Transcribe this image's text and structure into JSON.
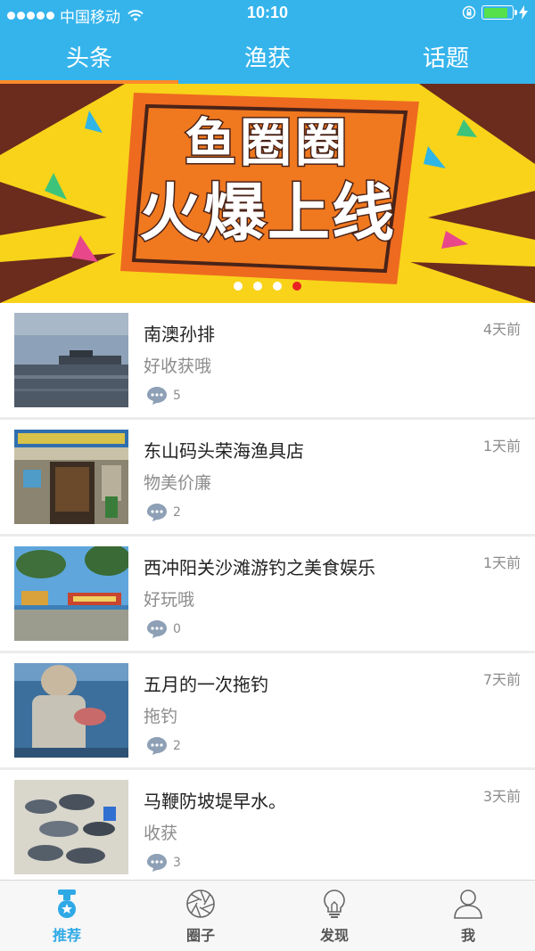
{
  "status_bar": {
    "carrier": "中国移动",
    "time": "10:10"
  },
  "top_tabs": [
    {
      "label": "头条",
      "active": true
    },
    {
      "label": "渔获",
      "active": false
    },
    {
      "label": "话题",
      "active": false
    }
  ],
  "banner": {
    "line1": "鱼圈圈",
    "line2": "火爆上线",
    "slide_count": 4,
    "active_slide": 4
  },
  "feed": [
    {
      "title": "南澳孙排",
      "subtitle": "好收获哦",
      "time": "4天前",
      "comments": "5"
    },
    {
      "title": "东山码头荣海渔具店",
      "subtitle": "物美价廉",
      "time": "1天前",
      "comments": "2"
    },
    {
      "title": "西冲阳关沙滩游钓之美食娱乐",
      "subtitle": "好玩哦",
      "time": "1天前",
      "comments": "0"
    },
    {
      "title": "五月的一次拖钓",
      "subtitle": "拖钓",
      "time": "7天前",
      "comments": "2"
    },
    {
      "title": "马鞭防坡堤早水。",
      "subtitle": "收获",
      "time": "3天前",
      "comments": "3"
    }
  ],
  "bottom_nav": [
    {
      "label": "推荐",
      "icon": "recommend-icon",
      "active": true
    },
    {
      "label": "圈子",
      "icon": "aperture-icon",
      "active": false
    },
    {
      "label": "发现",
      "icon": "bulb-icon",
      "active": false
    },
    {
      "label": "我",
      "icon": "person-icon",
      "active": false
    }
  ],
  "colors": {
    "header": "#35b4ec",
    "tab_indicator": "#ff8a2a",
    "banner_bg": "#f8d31a",
    "active_dot": "#e82323",
    "nav_active": "#2fa9e6"
  }
}
